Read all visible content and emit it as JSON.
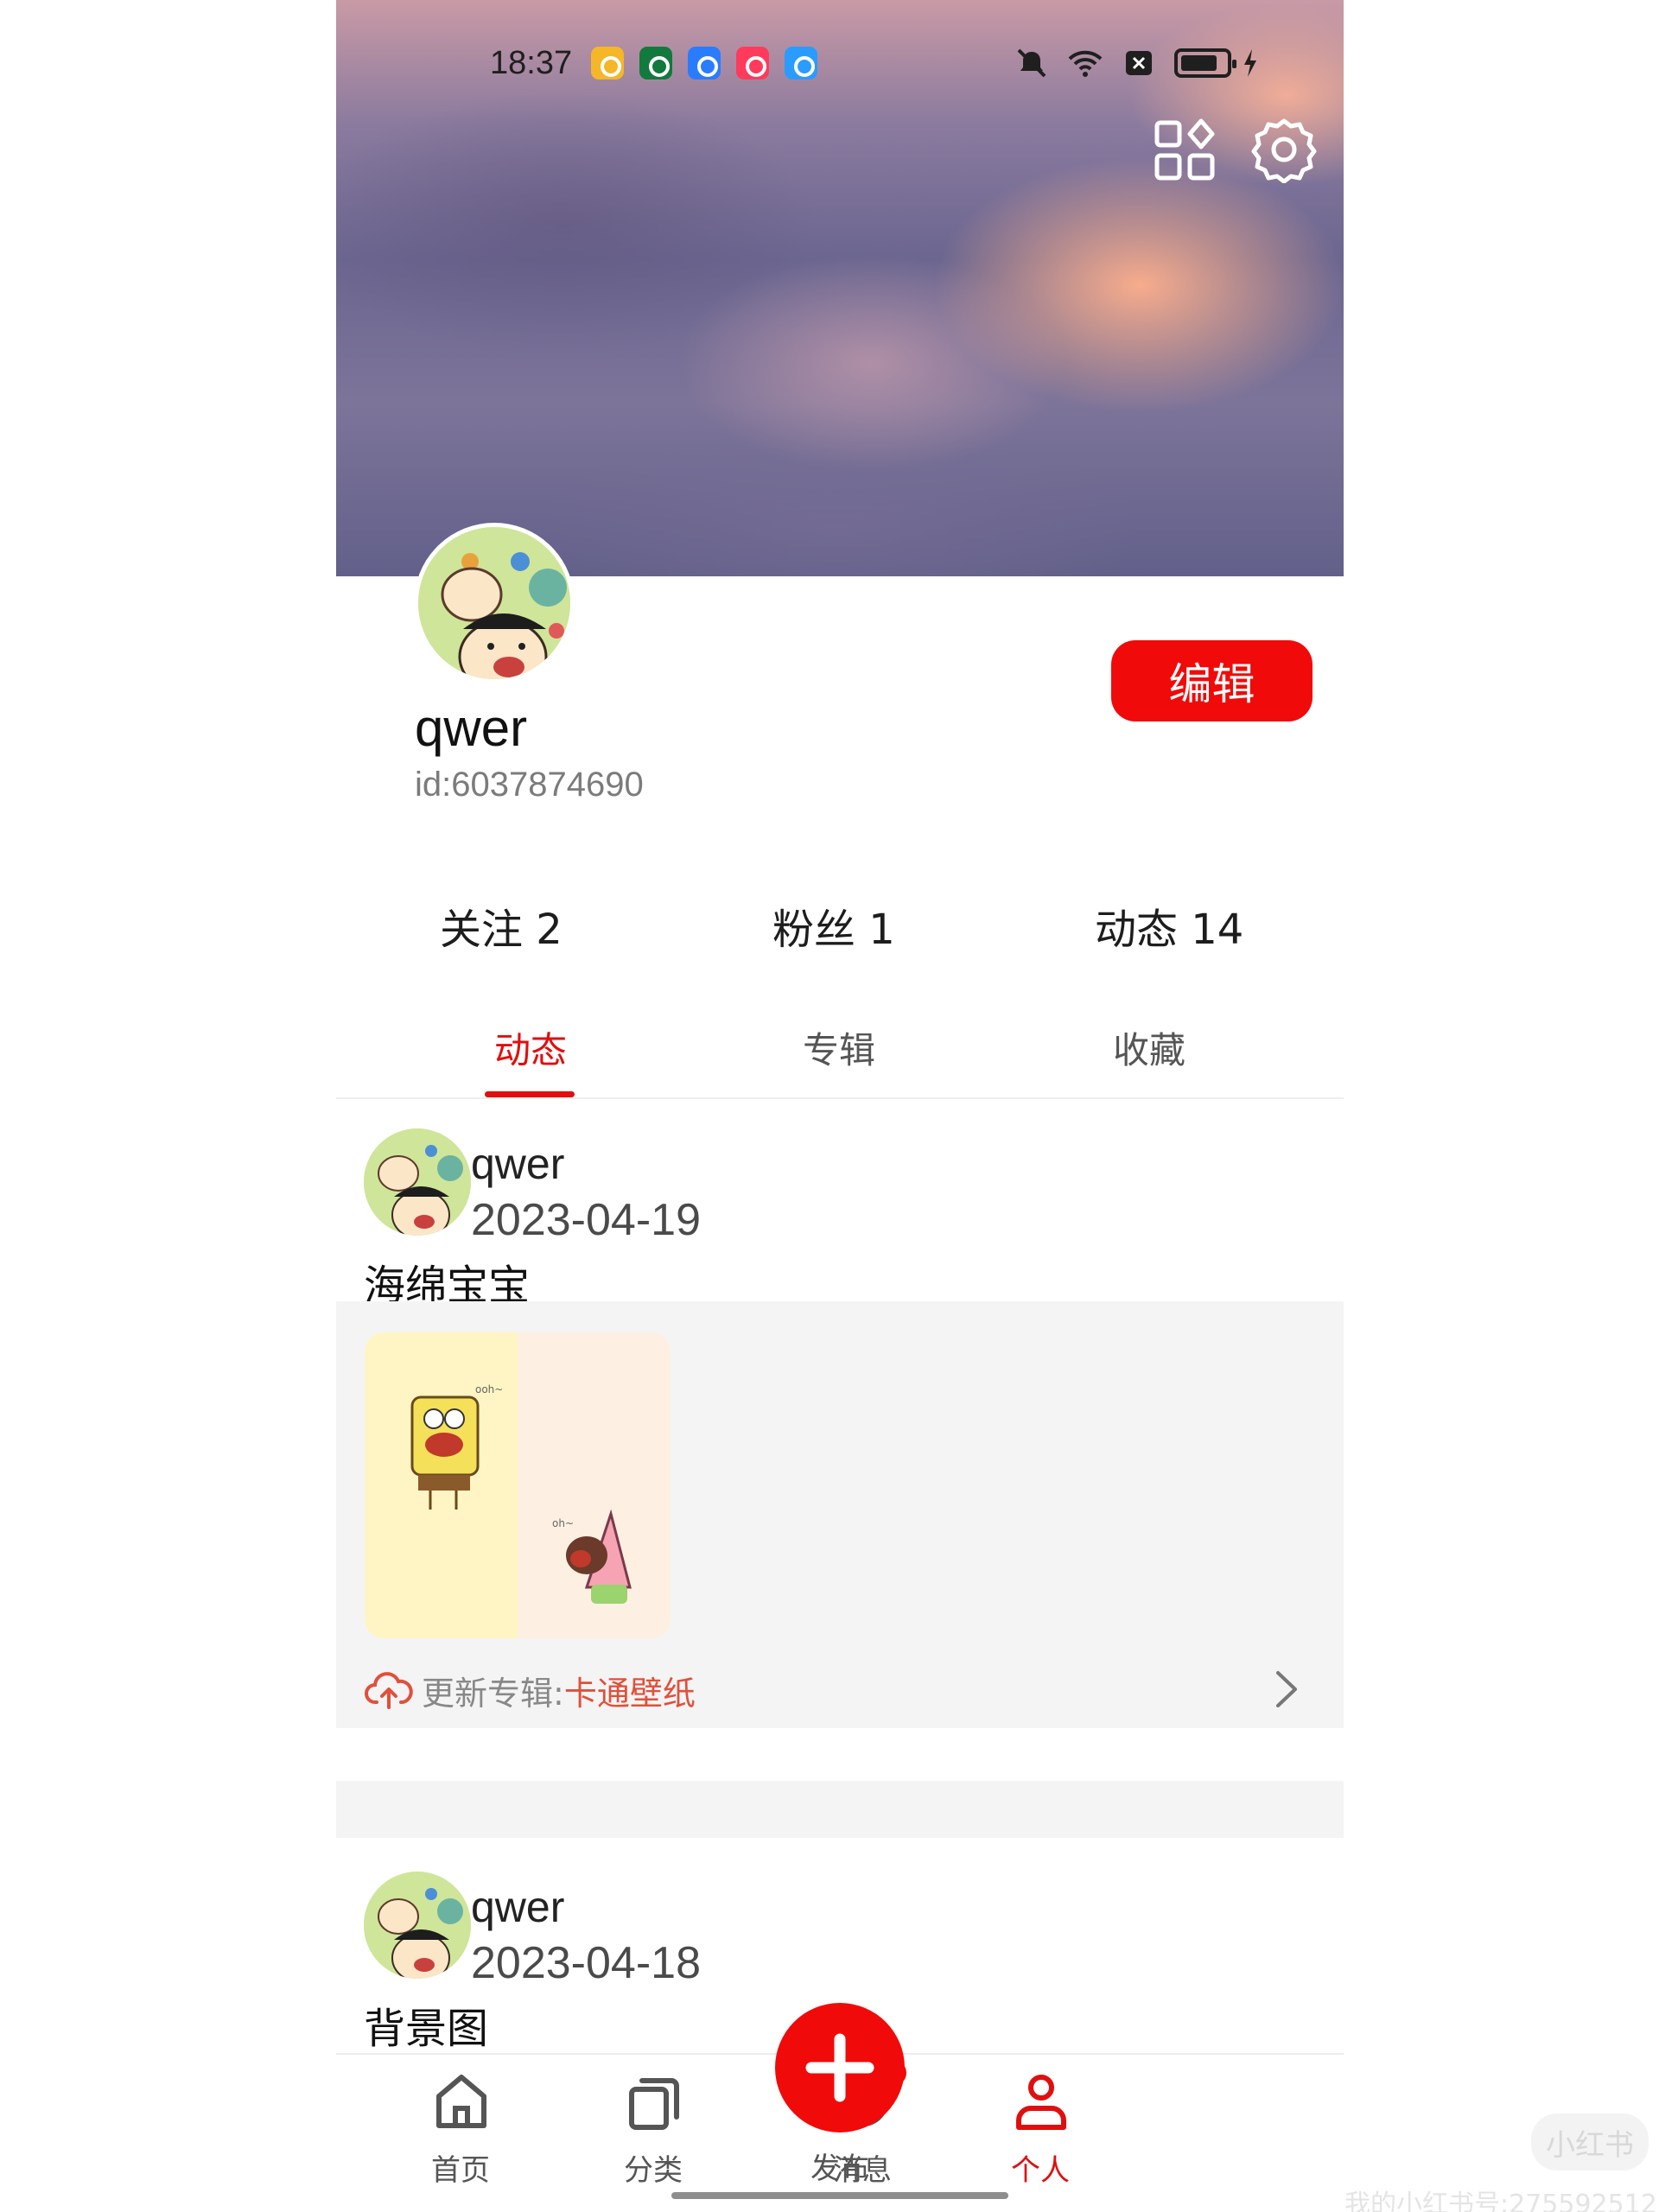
{
  "status_bar": {
    "time": "18:37"
  },
  "header": {
    "apps_icon": "apps-grid-icon",
    "settings_icon": "gear-icon"
  },
  "profile": {
    "username": "qwer",
    "id_text": "id:6037874690",
    "edit_label": "编辑"
  },
  "stats": {
    "following": "关注 2",
    "fans": "粉丝 1",
    "posts": "动态 14"
  },
  "tabs": [
    {
      "label": "动态",
      "active": true
    },
    {
      "label": "专辑",
      "active": false
    },
    {
      "label": "收藏",
      "active": false
    }
  ],
  "posts": [
    {
      "user": "qwer",
      "date": "2023-04-19",
      "text": "海绵宝宝",
      "album_prefix": "更新专辑:",
      "album_name": "卡通壁纸"
    },
    {
      "user": "qwer",
      "date": "2023-04-18",
      "text": "背景图"
    }
  ],
  "album_thumb_labels": {
    "a": "ooh~",
    "b": "oh~"
  },
  "nav": {
    "home": "首页",
    "category": "分类",
    "publish": "发布",
    "messages": "消息",
    "profile": "个人"
  },
  "watermark": {
    "logo": "小红书",
    "text": "我的小红书号:275592512"
  },
  "colors": {
    "accent": "#f10a0a",
    "album_link": "#e0503b"
  }
}
